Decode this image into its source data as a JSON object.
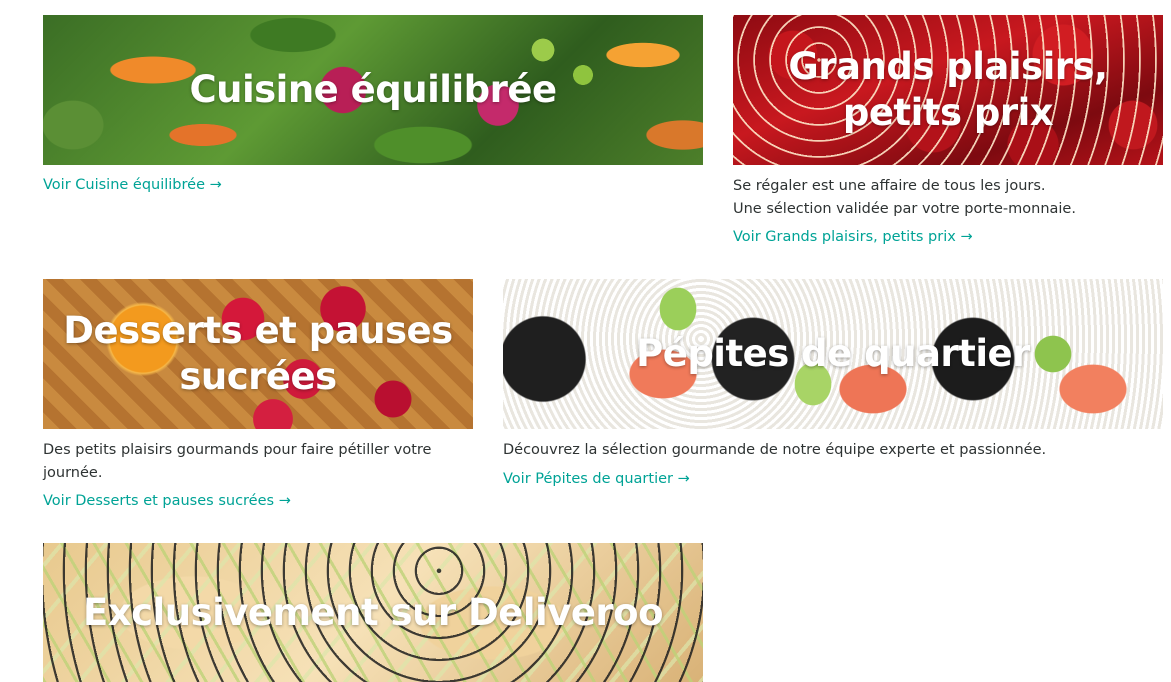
{
  "cards": [
    {
      "title": "Cuisine équilibrée",
      "description": "",
      "cta": "Voir Cuisine équilibrée →"
    },
    {
      "title": "Grands plaisirs, petits prix",
      "description": "Se régaler est une affaire de tous les jours. Une sélection validée par votre porte-monnaie.",
      "cta": "Voir Grands plaisirs, petits prix →"
    },
    {
      "title": "Desserts et pauses sucrées",
      "description": "Des petits plaisirs gourmands pour faire pétiller votre journée.",
      "cta": "Voir Desserts et pauses sucrées →"
    },
    {
      "title": "Pépites de quartier",
      "description": "Découvrez la sélection gourmande de notre équipe experte et passionnée.",
      "cta": "Voir Pépites de quartier →"
    },
    {
      "title": "Exclusivement sur Deliveroo",
      "description": "",
      "cta": ""
    }
  ],
  "colors": {
    "link": "#00a396",
    "text": "#2e3333",
    "banner_title": "#ffffff"
  }
}
